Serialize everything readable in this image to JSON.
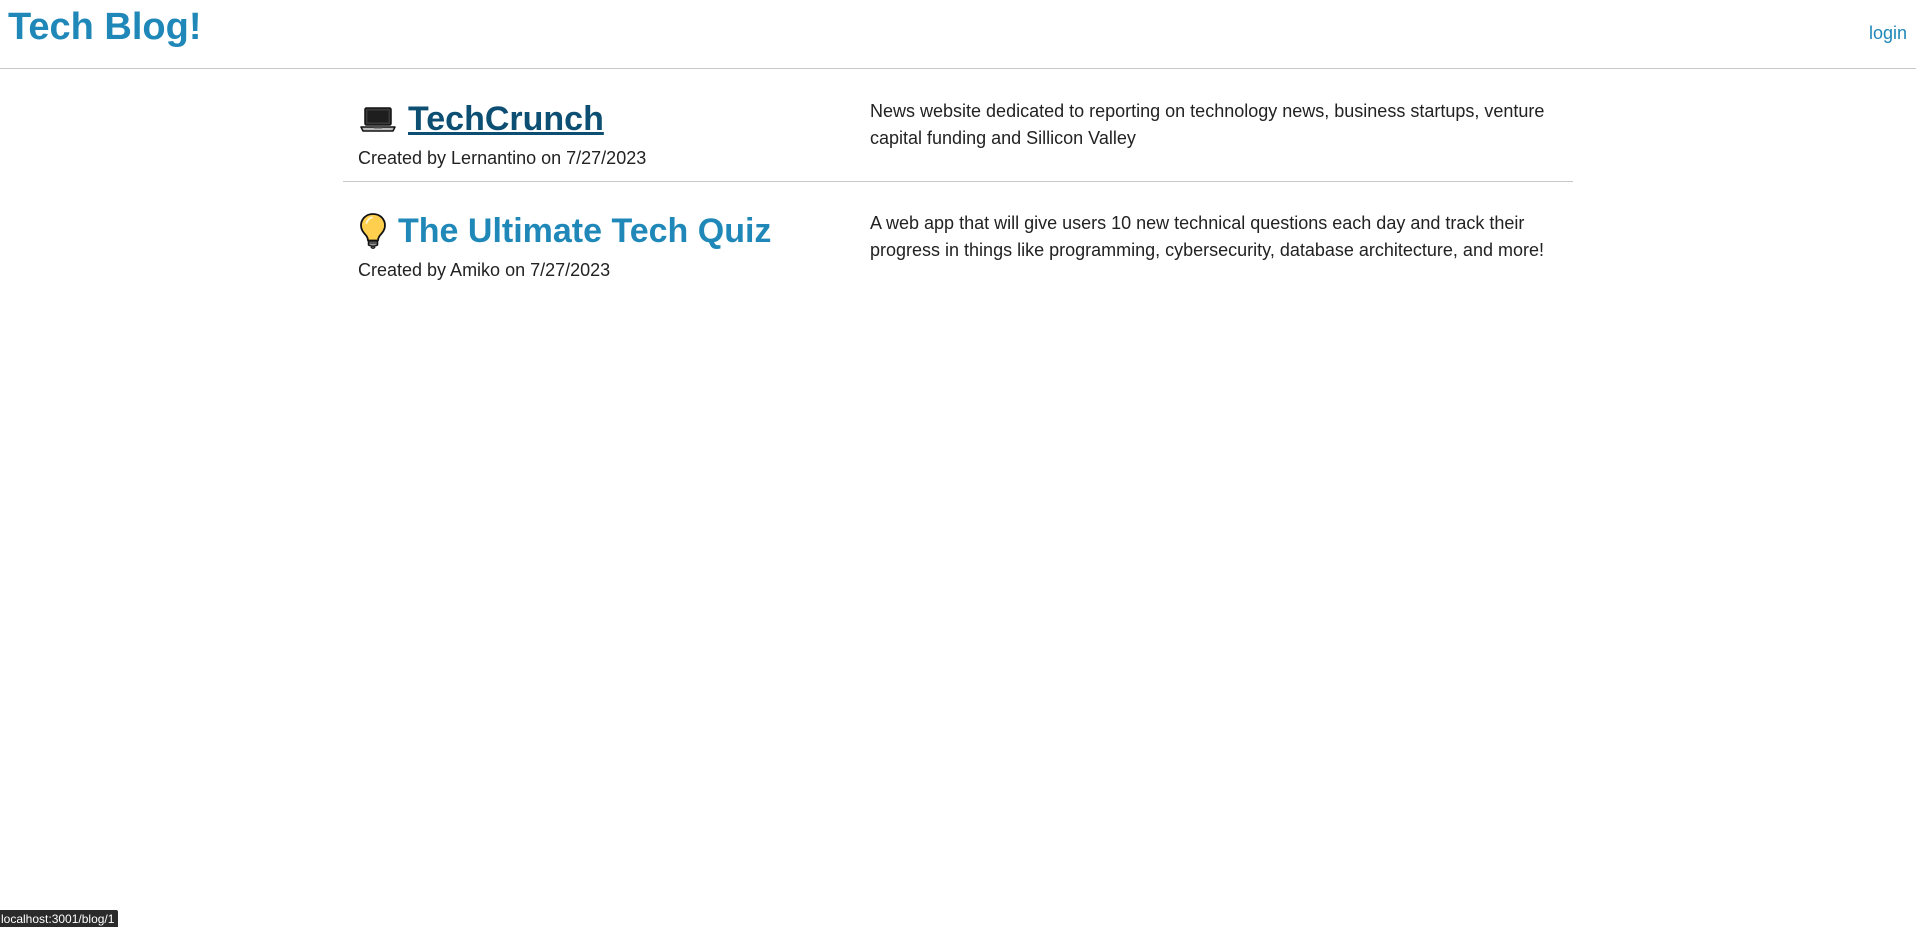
{
  "header": {
    "site_title": "Tech Blog!",
    "login_label": "login"
  },
  "posts": [
    {
      "icon": "laptop-icon",
      "title": "TechCrunch",
      "meta": "Created by Lernantino on 7/27/2023",
      "description": "News website dedicated to reporting on technology news, business startups, venture capital funding and Sillicon Valley"
    },
    {
      "icon": "lightbulb-icon",
      "title": "The Ultimate Tech Quiz",
      "meta": "Created by Amiko on 7/27/2023",
      "description": "A web app that will give users 10 new technical questions each day and track their progress in things like programming, cybersecurity, database architecture, and more!"
    }
  ],
  "status_bar": {
    "url": "localhost:3001/blog/1"
  },
  "colors": {
    "accent": "#1f88b8",
    "link_hover": "#0d4f73",
    "text": "#222222",
    "divider": "#c8c8c8"
  }
}
